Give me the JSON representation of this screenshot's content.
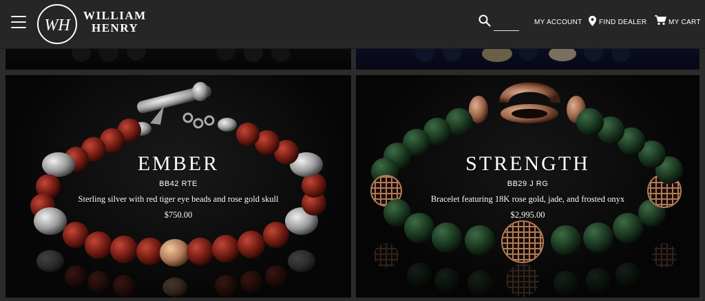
{
  "header": {
    "brand_line1": "WILLIAM",
    "brand_line2": "HENRY",
    "logo_monogram": "WH",
    "search_placeholder": "",
    "nav": {
      "account": "MY ACCOUNT",
      "dealer": "FIND DEALER",
      "cart": "MY CART"
    }
  },
  "products": [
    {
      "title": "EMBER",
      "sku": "BB42 RTE",
      "description": "Sterling silver with red tiger eye beads and rose gold skull",
      "price": "$750.00"
    },
    {
      "title": "STRENGTH",
      "sku": "BB29 J RG",
      "description": "Bracelet featuring 18K rose gold, jade, and frosted onyx",
      "price": "$2,995.00"
    }
  ],
  "colors": {
    "header_bg": "#262626",
    "page_bg": "#2b2b2b",
    "text": "#ffffff",
    "tiger_eye": "#8a2418",
    "jade": "#1c3a22",
    "silver": "#bdbdbd",
    "rose_gold": "#b07a5a"
  },
  "icons": {
    "menu": "hamburger-icon",
    "search": "search-icon",
    "dealer": "map-pin-icon",
    "cart": "cart-icon"
  }
}
